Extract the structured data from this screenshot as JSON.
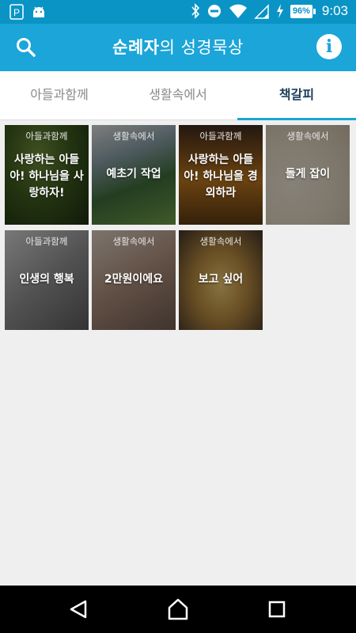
{
  "status_bar": {
    "time": "9:03",
    "battery_label": "96%",
    "icons": [
      "p-notification-icon",
      "android-icon",
      "bluetooth-icon",
      "do-not-disturb-icon",
      "wifi-icon",
      "signal-icon",
      "charging-icon"
    ]
  },
  "app_bar": {
    "title_bold": "순례자",
    "title_rest": "의 성경묵상",
    "left_icon": "search-icon",
    "right_icon": "info-icon",
    "info_glyph": "i"
  },
  "tabs": [
    {
      "label": "아들과함께",
      "active": false
    },
    {
      "label": "생활속에서",
      "active": false
    },
    {
      "label": "책갈피",
      "active": true
    }
  ],
  "bookmarks": [
    {
      "category": "아들과함께",
      "title": "사랑하는 아들아! 하나님을 사랑하자!"
    },
    {
      "category": "생활속에서",
      "title": "예초기 작업"
    },
    {
      "category": "아들과함께",
      "title": "사랑하는 아들아! 하나님을 경외하라"
    },
    {
      "category": "생활속에서",
      "title": "돌게 잡이"
    },
    {
      "category": "아들과함께",
      "title": "인생의 행복"
    },
    {
      "category": "생활속에서",
      "title": "2만원이에요"
    },
    {
      "category": "생활속에서",
      "title": "보고 싶어"
    }
  ],
  "colors": {
    "status_bar": "#0a94c6",
    "app_bar": "#1ba5d8",
    "tab_indicator": "#1ba5d8",
    "active_tab_text": "#1c3f5c",
    "background": "#efefef"
  },
  "nav_bar": {
    "icons": [
      "back-icon",
      "home-icon",
      "recent-apps-icon"
    ]
  }
}
